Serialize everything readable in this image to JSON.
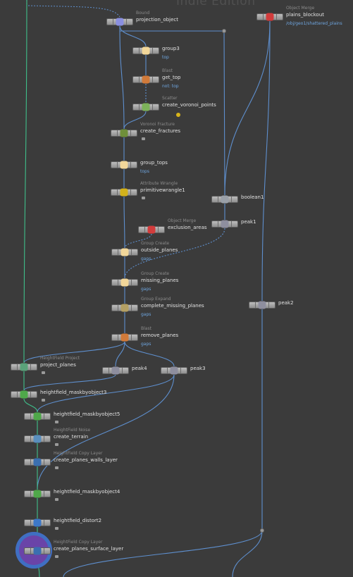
{
  "watermark": "Indie Edition",
  "nodes": [
    {
      "id": "projection_object",
      "type": "Bound",
      "name": "projection_object",
      "icon": "bound-icon"
    },
    {
      "id": "plains_blockout",
      "type": "Object Merge",
      "name": "plains_blockout",
      "sub": "/obj/geo1/shattered_plains",
      "icon": "object-merge-icon"
    },
    {
      "id": "group3",
      "type": "",
      "name": "group3",
      "sub": "top",
      "icon": "group-icon"
    },
    {
      "id": "get_top",
      "type": "Blast",
      "name": "get_top",
      "sub": "not: top",
      "icon": "blast-icon"
    },
    {
      "id": "create_voronoi_points",
      "type": "Scatter",
      "name": "create_voronoi_points",
      "icon": "scatter-icon",
      "warn": true
    },
    {
      "id": "create_fractures",
      "type": "Voronoi Fracture",
      "name": "create_fractures",
      "icon": "voronoi-fracture-icon",
      "lock": true
    },
    {
      "id": "group_tops",
      "type": "",
      "name": "group_tops",
      "sub": "tops",
      "icon": "group-icon"
    },
    {
      "id": "primitivewrangle1",
      "type": "Attribute Wrangle",
      "name": "primitivewrangle1",
      "icon": "attribute-wrangle-icon",
      "lock": true
    },
    {
      "id": "boolean1",
      "type": "",
      "name": "boolean1",
      "icon": "boolean-icon"
    },
    {
      "id": "peak1",
      "type": "",
      "name": "peak1",
      "icon": "peak-icon"
    },
    {
      "id": "exclusion_areas",
      "type": "Object Merge",
      "name": "exclusion_areas",
      "icon": "object-merge-icon"
    },
    {
      "id": "outside_planes",
      "type": "Group Create",
      "name": "outside_planes",
      "sub": "gaps",
      "icon": "group-icon"
    },
    {
      "id": "missing_planes",
      "type": "Group Create",
      "name": "missing_planes",
      "sub": "gaps",
      "icon": "group-icon"
    },
    {
      "id": "complete_missing_planes",
      "type": "Group Expand",
      "name": "complete_missing_planes",
      "sub": "gaps",
      "icon": "group-expand-icon"
    },
    {
      "id": "peak2",
      "type": "",
      "name": "peak2",
      "icon": "peak-icon"
    },
    {
      "id": "remove_planes",
      "type": "Blast",
      "name": "remove_planes",
      "sub": "gaps",
      "icon": "blast-icon"
    },
    {
      "id": "project_planes",
      "type": "HeightField Project",
      "name": "project_planes",
      "icon": "heightfield-project-icon",
      "lock": true
    },
    {
      "id": "peak4",
      "type": "",
      "name": "peak4",
      "icon": "peak-icon"
    },
    {
      "id": "peak3",
      "type": "",
      "name": "peak3",
      "icon": "peak-icon"
    },
    {
      "id": "heightfield_maskbyobject3",
      "type": "",
      "name": "heightfield_maskbyobject3",
      "icon": "heightfield-mask-icon",
      "lock": true
    },
    {
      "id": "heightfield_maskbyobject5",
      "type": "",
      "name": "heightfield_maskbyobject5",
      "icon": "heightfield-mask-icon",
      "lock": true
    },
    {
      "id": "create_terrain",
      "type": "HeightField Noise",
      "name": "create_terrain",
      "icon": "heightfield-noise-icon",
      "lock": true
    },
    {
      "id": "create_planes_walls_layer",
      "type": "HeightField Copy Layer",
      "name": "create_planes_walls_layer",
      "icon": "heightfield-copy-layer-icon",
      "lock": true
    },
    {
      "id": "heightfield_maskbyobject4",
      "type": "",
      "name": "heightfield_maskbyobject4",
      "icon": "heightfield-mask-icon",
      "lock": true
    },
    {
      "id": "heightfield_distort2",
      "type": "",
      "name": "heightfield_distort2",
      "icon": "heightfield-distort-icon",
      "lock": true
    },
    {
      "id": "create_planes_surface_layer",
      "type": "HeightField Copy Layer",
      "name": "create_planes_surface_layer",
      "icon": "heightfield-copy-layer-icon",
      "lock": true
    }
  ],
  "colors": {
    "background": "#3b3b3b",
    "wire": "#5e8fce",
    "wire_selected": "#3fbf8a",
    "display_flag": "#6a44a8",
    "render_flag": "#3f6fc2",
    "group_sub": "#6fa6e0"
  }
}
